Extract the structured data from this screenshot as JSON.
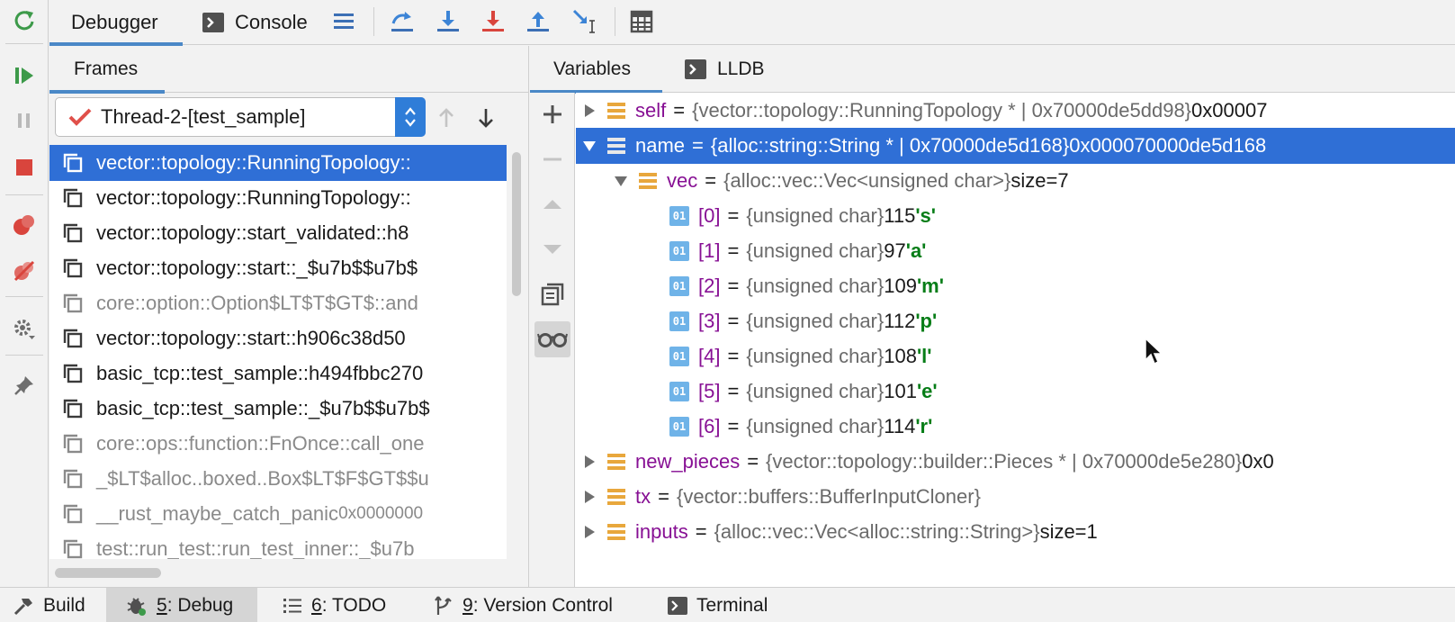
{
  "top_tabs": [
    {
      "label": "Debugger",
      "active": true
    },
    {
      "label": "Console",
      "active": false
    }
  ],
  "frames_tab": {
    "label": "Frames"
  },
  "thread_select": {
    "value": "Thread-2-[test_sample]"
  },
  "frames": [
    {
      "label": "vector::topology::RunningTopology::",
      "addr": "",
      "selected": true,
      "dim": false
    },
    {
      "label": "vector::topology::RunningTopology::",
      "addr": "",
      "selected": false,
      "dim": false
    },
    {
      "label": "vector::topology::start_validated::h8",
      "addr": "",
      "selected": false,
      "dim": false
    },
    {
      "label": "vector::topology::start::_$u7b$$u7b$",
      "addr": "",
      "selected": false,
      "dim": false
    },
    {
      "label": "core::option::Option$LT$T$GT$::and",
      "addr": "",
      "selected": false,
      "dim": true
    },
    {
      "label": "vector::topology::start::h906c38d50",
      "addr": "",
      "selected": false,
      "dim": false
    },
    {
      "label": "basic_tcp::test_sample::h494fbbc270",
      "addr": "",
      "selected": false,
      "dim": false
    },
    {
      "label": "basic_tcp::test_sample::_$u7b$$u7b$",
      "addr": "",
      "selected": false,
      "dim": false
    },
    {
      "label": "core::ops::function::FnOnce::call_one",
      "addr": "",
      "selected": false,
      "dim": true
    },
    {
      "label": "_$LT$alloc..boxed..Box$LT$F$GT$$u",
      "addr": "",
      "selected": false,
      "dim": true
    },
    {
      "label": "__rust_maybe_catch_panic ",
      "addr": "0x0000000",
      "selected": false,
      "dim": true
    },
    {
      "label": "test::run_test::run_test_inner::_$u7b",
      "addr": "",
      "selected": false,
      "dim": true
    }
  ],
  "vars_tabs": [
    {
      "label": "Variables",
      "active": true
    },
    {
      "label": "LLDB",
      "active": false
    }
  ],
  "variables": [
    {
      "indent": 0,
      "arrow": "collapsed",
      "icon": "field",
      "name": "self",
      "type": "{vector::topology::RunningTopology * | 0x70000de5dd98}",
      "value": "0x00007",
      "char": "",
      "selected": false
    },
    {
      "indent": 0,
      "arrow": "expanded",
      "icon": "field",
      "name": "name",
      "type": "{alloc::string::String * | 0x70000de5d168}",
      "value": "0x000070000de5d168",
      "char": "",
      "selected": true
    },
    {
      "indent": 1,
      "arrow": "expanded",
      "icon": "field",
      "name": "vec",
      "type": "{alloc::vec::Vec<unsigned char>}",
      "value": "size=7",
      "char": "",
      "selected": false
    },
    {
      "indent": 2,
      "arrow": "none",
      "icon": "prim",
      "name": "[0]",
      "type": "{unsigned char}",
      "value": "115",
      "char": "'s'",
      "selected": false
    },
    {
      "indent": 2,
      "arrow": "none",
      "icon": "prim",
      "name": "[1]",
      "type": "{unsigned char}",
      "value": "97",
      "char": "'a'",
      "selected": false
    },
    {
      "indent": 2,
      "arrow": "none",
      "icon": "prim",
      "name": "[2]",
      "type": "{unsigned char}",
      "value": "109",
      "char": "'m'",
      "selected": false
    },
    {
      "indent": 2,
      "arrow": "none",
      "icon": "prim",
      "name": "[3]",
      "type": "{unsigned char}",
      "value": "112",
      "char": "'p'",
      "selected": false
    },
    {
      "indent": 2,
      "arrow": "none",
      "icon": "prim",
      "name": "[4]",
      "type": "{unsigned char}",
      "value": "108",
      "char": "'l'",
      "selected": false
    },
    {
      "indent": 2,
      "arrow": "none",
      "icon": "prim",
      "name": "[5]",
      "type": "{unsigned char}",
      "value": "101",
      "char": "'e'",
      "selected": false
    },
    {
      "indent": 2,
      "arrow": "none",
      "icon": "prim",
      "name": "[6]",
      "type": "{unsigned char}",
      "value": "114",
      "char": "'r'",
      "selected": false
    },
    {
      "indent": 0,
      "arrow": "collapsed",
      "icon": "field",
      "name": "new_pieces",
      "type": "{vector::topology::builder::Pieces * | 0x70000de5e280}",
      "value": "0x0",
      "char": "",
      "selected": false
    },
    {
      "indent": 0,
      "arrow": "collapsed",
      "icon": "field",
      "name": "tx",
      "type": "{vector::buffers::BufferInputCloner}",
      "value": "",
      "char": "",
      "selected": false
    },
    {
      "indent": 0,
      "arrow": "collapsed",
      "icon": "field",
      "name": "inputs",
      "type": "{alloc::vec::Vec<alloc::string::String>}",
      "value": "size=1",
      "char": "",
      "selected": false
    }
  ],
  "prim_icon_text": "01",
  "bottom_bar": [
    {
      "num": "",
      "label": "Build",
      "active": false,
      "icon": "hammer-icon"
    },
    {
      "num": "5",
      "label": ": Debug",
      "active": true,
      "icon": "bug-icon"
    },
    {
      "num": "6",
      "label": ": TODO",
      "active": false,
      "icon": "list-icon"
    },
    {
      "num": "9",
      "label": ": Version Control",
      "active": false,
      "icon": "vcs-icon"
    },
    {
      "num": "",
      "label": "Terminal",
      "active": false,
      "icon": "terminal-icon"
    }
  ],
  "colors": {
    "accent": "#4a88c7",
    "selection": "#2f6fd6",
    "var_name": "#871094",
    "char_literal": "#067d17"
  }
}
